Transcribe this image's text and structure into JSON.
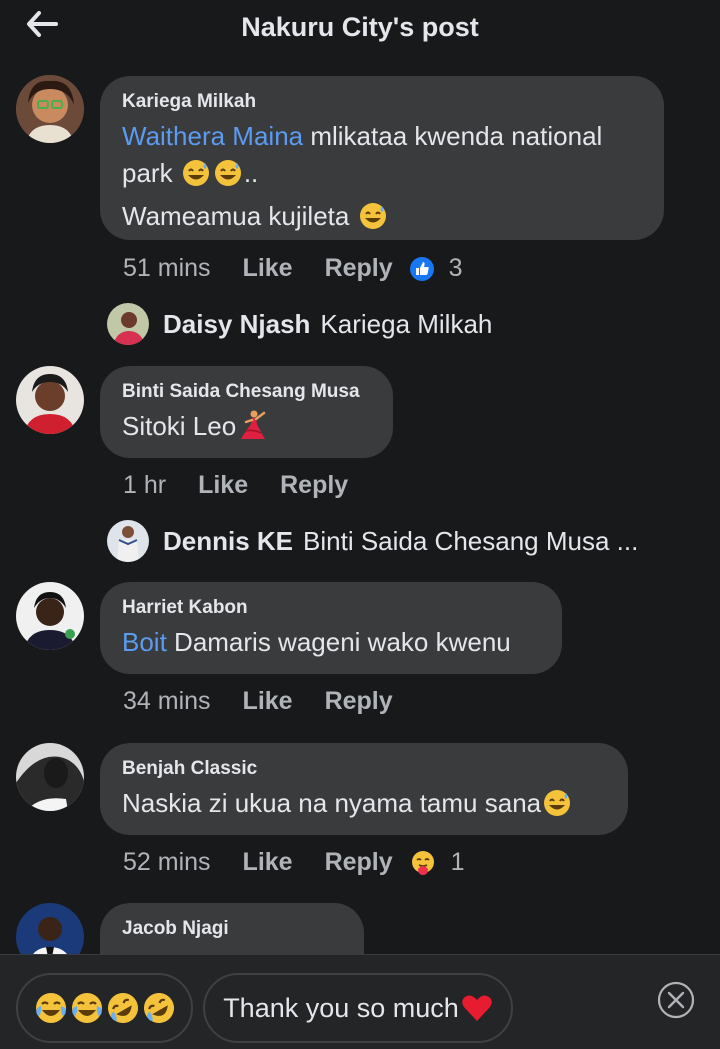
{
  "header": {
    "title": "Nakuru City's post"
  },
  "comments": [
    {
      "author": "Kariega Milkah",
      "mention": "Waithera Maina",
      "text_line1": " mlikataa kwenda national",
      "text_line2": "park",
      "text_line2_tail": "..",
      "text_line3": "Wameamua kujileta",
      "time": "51 mins",
      "like": "Like",
      "reply": "Reply",
      "reaction_count": "3",
      "reaction_icon": "thumbs-up-icon"
    },
    {
      "author": "Binti Saida Chesang Musa",
      "text": "Sitoki Leo",
      "time": "1 hr",
      "like": "Like",
      "reply": "Reply"
    },
    {
      "author": "Harriet Kabon",
      "mention": "Boit",
      "text": " Damaris wageni wako kwenu",
      "time": "34 mins",
      "like": "Like",
      "reply": "Reply"
    },
    {
      "author": "Benjah Classic",
      "text": "Naskia zi ukua na nyama tamu sana",
      "time": "52 mins",
      "like": "Like",
      "reply": "Reply",
      "reaction_count": "1",
      "reaction_icon": "care-hug-icon"
    },
    {
      "author": "Jacob Njagi"
    }
  ],
  "replies": [
    {
      "name": "Daisy Njash",
      "text": "Kariega Milkah"
    },
    {
      "name": "Dennis KE",
      "text": "Binti Saida Chesang Musa ..."
    }
  ],
  "suggestions": {
    "emoji_chip": "laughing-emoji-chip",
    "text_chip": "Thank you so much"
  },
  "colors": {
    "background": "#18191a",
    "bubble": "#3a3b3c",
    "mention": "#5b9bf1",
    "meta_text": "#b0b3b8",
    "like_blue": "#1877f2"
  }
}
